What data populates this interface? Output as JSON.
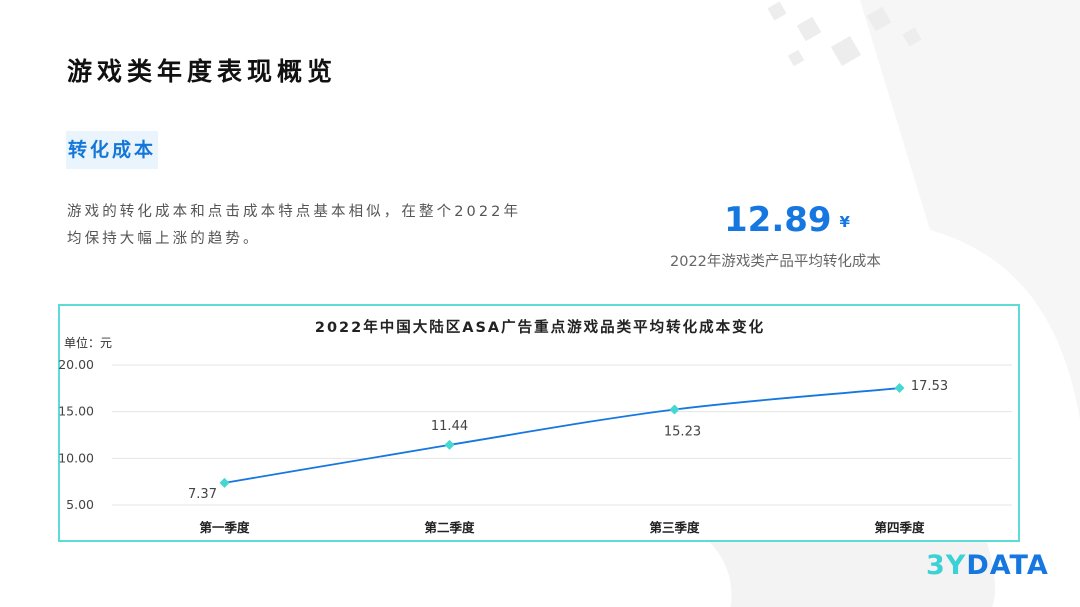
{
  "page": {
    "title": "游戏类年度表现概览",
    "section_tag": "转化成本",
    "description": "游戏的转化成本和点击成本特点基本相似，在整个2022年均保持大幅上涨的趋势。",
    "kpi": {
      "value": "12.89",
      "unit": "¥",
      "caption": "2022年游戏类产品平均转化成本"
    },
    "brand": {
      "part1": "3Y",
      "part2": "DATA"
    }
  },
  "colors": {
    "accent": "#1677e0",
    "line": "#1677e0",
    "marker": "#45d8d2",
    "border": "#5ddcd6",
    "tag_bg": "#eaf4fd"
  },
  "chart_data": {
    "type": "line",
    "title": "2022年中国大陆区ASA广告重点游戏品类平均转化成本变化",
    "ylabel": "单位：元",
    "xlabel": "",
    "categories": [
      "第一季度",
      "第二季度",
      "第三季度",
      "第四季度"
    ],
    "series": [
      {
        "values": [
          7.37,
          11.44,
          15.23,
          17.53
        ],
        "data_labels": [
          "7.37",
          "11.44",
          "15.23",
          "17.53"
        ]
      }
    ],
    "yticks": [
      5,
      10,
      15,
      20
    ],
    "ytick_labels": [
      "5.00",
      "10.00",
      "15.00",
      "20.00"
    ],
    "ylim": [
      5,
      20
    ],
    "grid": true,
    "legend": "none"
  }
}
